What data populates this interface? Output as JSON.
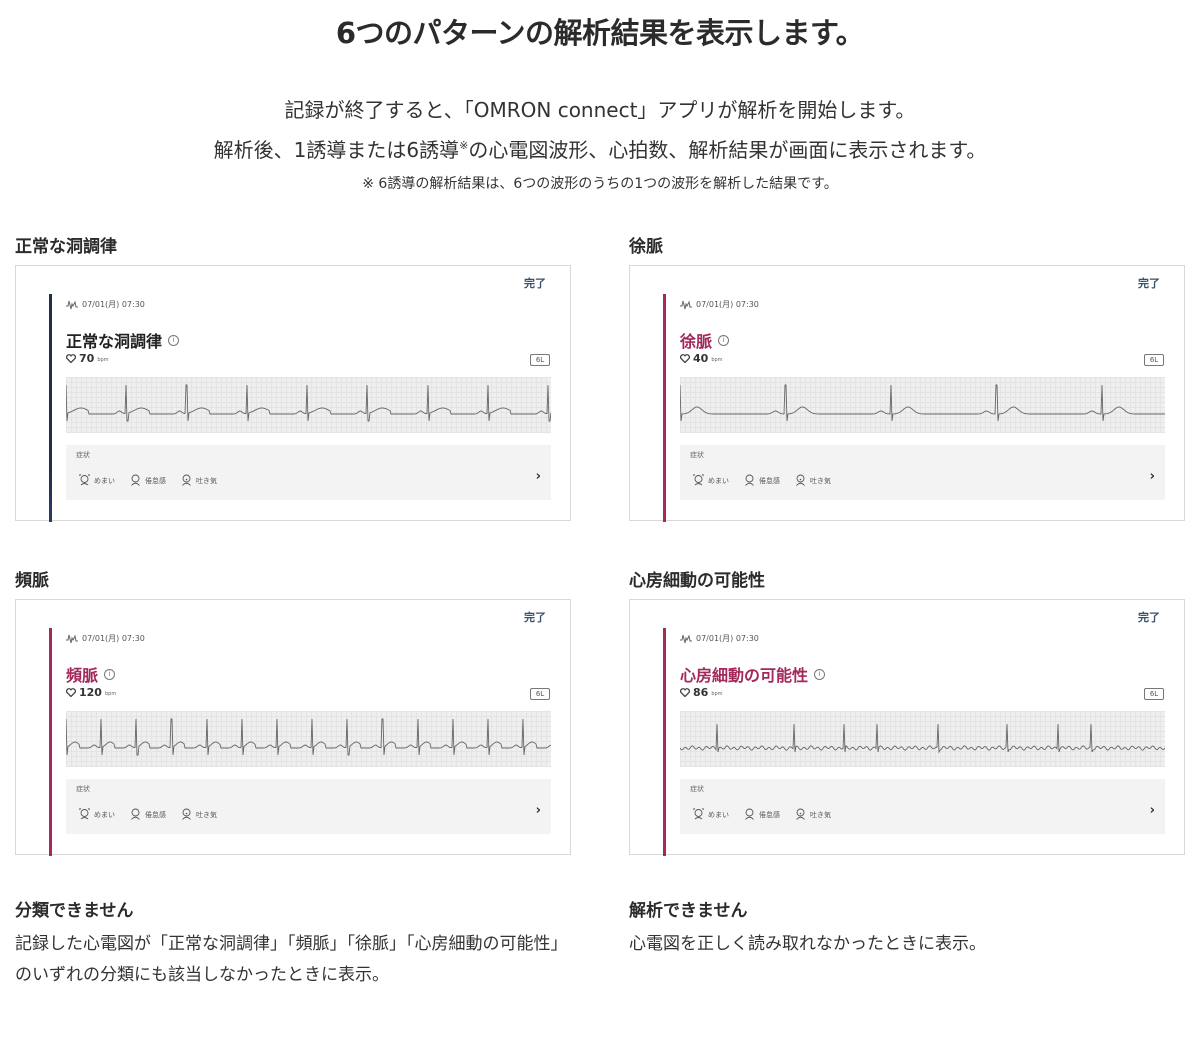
{
  "title": "6つのパターンの解析結果を表示します。",
  "intro": {
    "line1": "記録が終了すると、「OMRON connect」アプリが解析を開始します。",
    "line2_before": "解析後、1誘導または6誘導",
    "line2_mark": "※",
    "line2_after": "の心電図波形、心拍数、解析結果が画面に表示されます。",
    "note": "※ 6誘導の解析結果は、6つの波形のうちの1つの波形を解析した結果です。"
  },
  "colors": {
    "normal_accent": "#1f2f4f",
    "abnormal_accent": "#a3295c",
    "abnormal_text": "#a3295c",
    "normal_text": "#222222"
  },
  "cards": [
    {
      "heading": "正常な洞調律",
      "done_label": "完了",
      "datetime": "07/01(月) 07:30",
      "result": "正常な洞調律",
      "bpm": "70",
      "bpm_unit": "bpm",
      "lead": "6L",
      "variant": "normal",
      "symptoms_label": "症状",
      "symptoms": [
        "めまい",
        "倦怠感",
        "吐き気"
      ]
    },
    {
      "heading": "徐脈",
      "done_label": "完了",
      "datetime": "07/01(月) 07:30",
      "result": "徐脈",
      "bpm": "40",
      "bpm_unit": "bpm",
      "lead": "6L",
      "variant": "brady",
      "symptoms_label": "症状",
      "symptoms": [
        "めまい",
        "倦怠感",
        "吐き気"
      ]
    },
    {
      "heading": "頻脈",
      "done_label": "完了",
      "datetime": "07/01(月) 07:30",
      "result": "頻脈",
      "bpm": "120",
      "bpm_unit": "bpm",
      "lead": "6L",
      "variant": "tachy",
      "symptoms_label": "症状",
      "symptoms": [
        "めまい",
        "倦怠感",
        "吐き気"
      ]
    },
    {
      "heading": "心房細動の可能性",
      "done_label": "完了",
      "datetime": "07/01(月) 07:30",
      "result": "心房細動の可能性",
      "bpm": "86",
      "bpm_unit": "bpm",
      "lead": "6L",
      "variant": "afib",
      "symptoms_label": "症状",
      "symptoms": [
        "めまい",
        "倦怠感",
        "吐き気"
      ]
    }
  ],
  "notes": [
    {
      "heading": "分類できません",
      "text": "記録した心電図が「正常な洞調律」「頻脈」「徐脈」「心房細動の可能性」のいずれの分類にも該当しなかったときに表示。"
    },
    {
      "heading": "解析できません",
      "text": "心電図を正しく読み取れなかったときに表示。"
    }
  ]
}
